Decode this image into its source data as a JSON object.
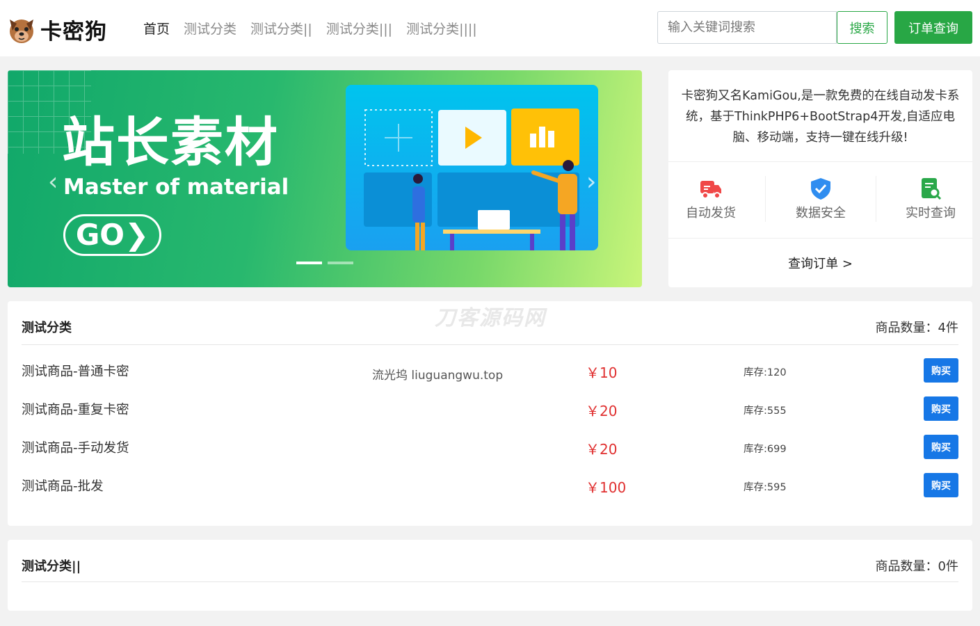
{
  "header": {
    "logo_text": "卡密狗",
    "nav": [
      "首页",
      "测试分类",
      "测试分类||",
      "测试分类|||",
      "测试分类||||"
    ],
    "search_placeholder": "输入关键词搜索",
    "search_label": "搜索",
    "order_label": "订单查询"
  },
  "banner": {
    "title": "站长素材",
    "subtitle": "Master of material",
    "go": "GO❯",
    "slides_total": 2,
    "slide_active": 1
  },
  "info": {
    "description": "卡密狗又名KamiGou,是一款免费的在线自动发卡系统，基于ThinkPHP6+BootStrap4开发,自适应电脑、移动端，支持一键在线升级!",
    "features": [
      {
        "label": "自动发货",
        "icon": "delivery-truck-icon",
        "color": "#f04848"
      },
      {
        "label": "数据安全",
        "icon": "shield-check-icon",
        "color": "#2f8df0"
      },
      {
        "label": "实时查询",
        "icon": "document-search-icon",
        "color": "#2aa84a"
      }
    ],
    "query_link": "查询订单 >"
  },
  "categories": [
    {
      "title": "测试分类",
      "count": "商品数量：4件",
      "products": [
        {
          "name": "测试商品-普通卡密",
          "price": "￥10",
          "stock": "库存:120",
          "buy": "购买"
        },
        {
          "name": "测试商品-重复卡密",
          "price": "￥20",
          "stock": "库存:555",
          "buy": "购买"
        },
        {
          "name": "测试商品-手动发货",
          "price": "￥20",
          "stock": "库存:699",
          "buy": "购买"
        },
        {
          "name": "测试商品-批发",
          "price": "￥100",
          "stock": "库存:595",
          "buy": "购买"
        }
      ]
    },
    {
      "title": "测试分类||",
      "count": "商品数量：0件",
      "products": []
    }
  ],
  "watermarks": [
    "流光坞 liuguangwu.top",
    "刀客源码网"
  ],
  "colors": {
    "accent": "#28a745",
    "price": "#e03030",
    "buy": "#1677e6"
  }
}
